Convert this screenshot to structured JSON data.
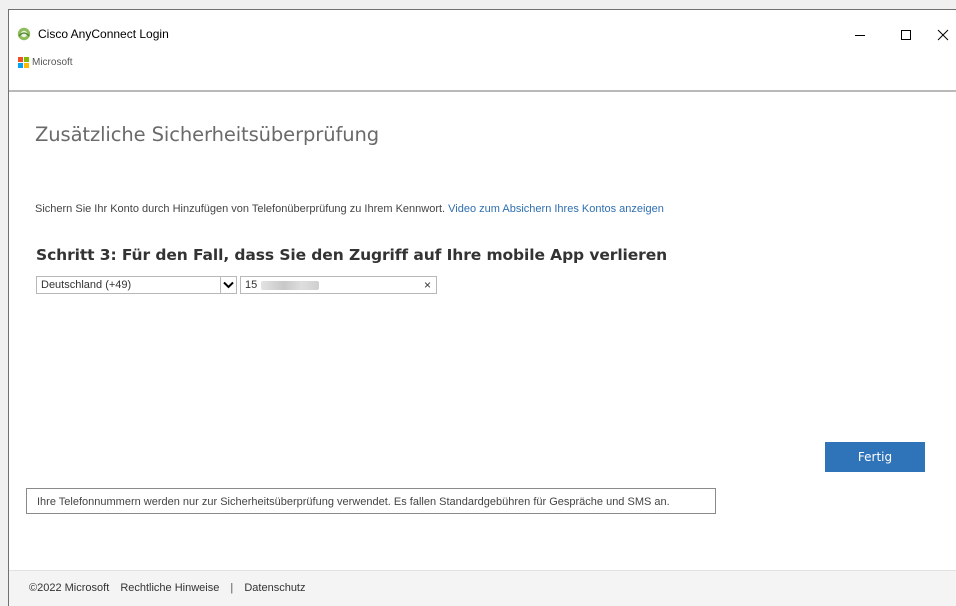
{
  "window": {
    "title": "Cisco AnyConnect Login",
    "brand": "Microsoft"
  },
  "page": {
    "heading": "Zusätzliche Sicherheitsüberprüfung",
    "intro_text": "Sichern Sie Ihr Konto durch Hinzufügen von Telefonüberprüfung zu Ihrem Kennwort.",
    "intro_link": "Video zum Absichern Ihres Kontos anzeigen",
    "step_title": "Schritt 3: Für den Fall, dass Sie den Zugriff auf Ihre mobile App verlieren"
  },
  "form": {
    "country_value": "Deutschland (+49)",
    "phone_prefix": "15",
    "clear_symbol": "×",
    "done_label": "Fertig"
  },
  "notice": {
    "text": "Ihre Telefonnummern werden nur zur Sicherheitsüberprüfung verwendet. Es fallen Standardgebühren für Gespräche und SMS an."
  },
  "footer": {
    "copyright": "©2022 Microsoft",
    "legal": "Rechtliche Hinweise",
    "separator": "|",
    "privacy": "Datenschutz"
  },
  "icons": {
    "app": "cisco-anyconnect-icon",
    "brand": "microsoft-logo-icon",
    "minimize": "minimize-icon",
    "maximize": "maximize-icon",
    "close": "close-icon",
    "dropdown": "chevron-down-icon"
  },
  "colors": {
    "accent": "#2f73b8",
    "link": "#2f6fb0"
  }
}
